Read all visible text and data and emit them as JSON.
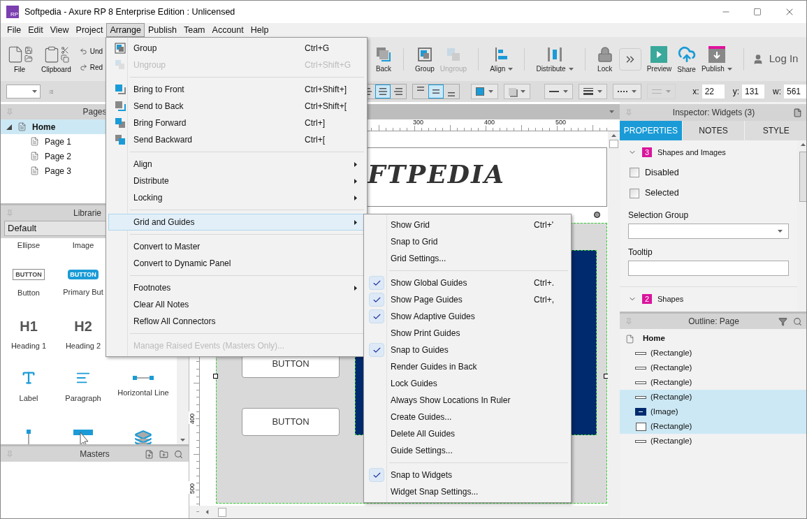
{
  "window": {
    "logo_text": "RP",
    "title": "Softpedia - Axure RP 8 Enterprise Edition : Unlicensed"
  },
  "menubar": [
    {
      "label": "File",
      "selected": false
    },
    {
      "label": "Edit",
      "selected": false
    },
    {
      "label": "View",
      "selected": false
    },
    {
      "label": "Project",
      "selected": false
    },
    {
      "label": "Arrange",
      "selected": true
    },
    {
      "label": "Publish",
      "selected": false
    },
    {
      "label": "Team",
      "selected": false
    },
    {
      "label": "Account",
      "selected": false
    },
    {
      "label": "Help",
      "selected": false
    }
  ],
  "toolbar_left": [
    {
      "label": "File"
    },
    {
      "label": "Clipboard"
    }
  ],
  "undo_redo": [
    "Und",
    "Red"
  ],
  "toolbar_right": [
    {
      "label": "Back",
      "disabled": false,
      "has_menu": false
    },
    {
      "label": "Group",
      "disabled": false,
      "has_menu": false
    },
    {
      "label": "Ungroup",
      "disabled": true,
      "has_menu": false
    },
    {
      "label": "Align",
      "disabled": false,
      "has_menu": true
    },
    {
      "label": "Distribute",
      "disabled": false,
      "has_menu": true
    },
    {
      "label": "Lock",
      "disabled": false,
      "has_menu": false
    },
    {
      "label": "Preview",
      "disabled": false,
      "has_menu": false
    },
    {
      "label": "Share",
      "disabled": false,
      "has_menu": false
    },
    {
      "label": "Publish",
      "disabled": false,
      "has_menu": true
    }
  ],
  "login": "Log In",
  "format_bar": {
    "h_align": [
      {
        "selected": false
      },
      {
        "selected": true
      },
      {
        "selected": false
      }
    ],
    "v_align": [
      {
        "selected": false
      },
      {
        "selected": true
      },
      {
        "selected": false
      }
    ],
    "fields": [
      {
        "label": "x:",
        "value": "22"
      },
      {
        "label": "y:",
        "value": "131"
      },
      {
        "label": "w:",
        "value": "561"
      }
    ]
  },
  "pages": {
    "title": "Pages",
    "tree": [
      {
        "label": "Home",
        "selected": true,
        "expanded": true,
        "children": [
          {
            "label": "Page 1",
            "selected": false
          },
          {
            "label": "Page 2",
            "selected": false
          },
          {
            "label": "Page 3",
            "selected": false
          }
        ]
      }
    ]
  },
  "libraries": {
    "title": "Librarie",
    "library": "Default",
    "rows": [
      [
        {
          "label": "Ellipse"
        },
        {
          "label": "Image"
        }
      ],
      [
        {
          "label": "Button",
          "icon_text": "BUTTON"
        },
        {
          "label": "Primary But",
          "icon_text": "BUTTON"
        }
      ],
      [
        {
          "label": "Heading 1",
          "icon_text": "H1"
        },
        {
          "label": "Heading 2",
          "icon_text": "H2"
        }
      ],
      [
        {
          "label": "Label"
        },
        {
          "label": "Paragraph"
        },
        {
          "label": "Horizontal Line"
        }
      ],
      [
        {},
        {},
        {}
      ]
    ]
  },
  "masters": {
    "title": "Masters"
  },
  "canvas": {
    "h_ruler": [
      "300",
      "400",
      "500"
    ],
    "v_ruler": [
      "400",
      "500"
    ],
    "logo": "FTPEDIA",
    "buttons": [
      "BUTTON",
      "BUTTON"
    ]
  },
  "arrange_menu": [
    {
      "kind": "item",
      "label": "Group",
      "shortcut": "Ctrl+G",
      "disabled": false,
      "submenu": false,
      "selected": false
    },
    {
      "kind": "item",
      "label": "Ungroup",
      "shortcut": "Ctrl+Shift+G",
      "disabled": true,
      "submenu": false,
      "selected": false
    },
    {
      "kind": "separator"
    },
    {
      "kind": "item",
      "label": "Bring to Front",
      "shortcut": "Ctrl+Shift+]",
      "disabled": false,
      "submenu": false,
      "selected": false
    },
    {
      "kind": "item",
      "label": "Send to Back",
      "shortcut": "Ctrl+Shift+[",
      "disabled": false,
      "submenu": false,
      "selected": false
    },
    {
      "kind": "item",
      "label": "Bring Forward",
      "shortcut": "Ctrl+]",
      "disabled": false,
      "submenu": false,
      "selected": false
    },
    {
      "kind": "item",
      "label": "Send Backward",
      "shortcut": "Ctrl+[",
      "disabled": false,
      "submenu": false,
      "selected": false
    },
    {
      "kind": "separator"
    },
    {
      "kind": "item",
      "label": "Align",
      "disabled": false,
      "submenu": true,
      "selected": false
    },
    {
      "kind": "item",
      "label": "Distribute",
      "disabled": false,
      "submenu": true,
      "selected": false
    },
    {
      "kind": "item",
      "label": "Locking",
      "disabled": false,
      "submenu": true,
      "selected": false
    },
    {
      "kind": "separator"
    },
    {
      "kind": "item",
      "label": "Grid and Guides",
      "disabled": false,
      "submenu": true,
      "selected": true
    },
    {
      "kind": "separator"
    },
    {
      "kind": "item",
      "label": "Convert to Master",
      "disabled": false,
      "submenu": false,
      "selected": false
    },
    {
      "kind": "item",
      "label": "Convert to Dynamic Panel",
      "disabled": false,
      "submenu": false,
      "selected": false
    },
    {
      "kind": "separator"
    },
    {
      "kind": "item",
      "label": "Footnotes",
      "disabled": false,
      "submenu": true,
      "selected": false
    },
    {
      "kind": "item",
      "label": "Clear All Notes",
      "disabled": false,
      "submenu": false,
      "selected": false
    },
    {
      "kind": "item",
      "label": "Reflow All Connectors",
      "disabled": false,
      "submenu": false,
      "selected": false
    },
    {
      "kind": "separator"
    },
    {
      "kind": "item",
      "label": "Manage Raised Events (Masters Only)...",
      "disabled": true,
      "submenu": false,
      "selected": false
    }
  ],
  "guides_menu": [
    {
      "kind": "item",
      "label": "Show Grid",
      "shortcut": "Ctrl+'",
      "checked": false
    },
    {
      "kind": "item",
      "label": "Snap to Grid",
      "checked": false
    },
    {
      "kind": "item",
      "label": "Grid Settings...",
      "checked": false
    },
    {
      "kind": "separator"
    },
    {
      "kind": "item",
      "label": "Show Global Guides",
      "shortcut": "Ctrl+.",
      "checked": true
    },
    {
      "kind": "item",
      "label": "Show Page Guides",
      "shortcut": "Ctrl+,",
      "checked": true
    },
    {
      "kind": "item",
      "label": "Show Adaptive Guides",
      "checked": true
    },
    {
      "kind": "item",
      "label": "Show Print Guides",
      "checked": false
    },
    {
      "kind": "item",
      "label": "Snap to Guides",
      "checked": true
    },
    {
      "kind": "item",
      "label": "Render Guides in Back",
      "checked": false
    },
    {
      "kind": "item",
      "label": "Lock Guides",
      "checked": false
    },
    {
      "kind": "item",
      "label": "Always Show Locations In Ruler",
      "checked": false
    },
    {
      "kind": "item",
      "label": "Create Guides...",
      "checked": false
    },
    {
      "kind": "item",
      "label": "Delete All Guides",
      "checked": false
    },
    {
      "kind": "item",
      "label": "Guide Settings...",
      "checked": false
    },
    {
      "kind": "separator"
    },
    {
      "kind": "item",
      "label": "Snap to Widgets",
      "checked": true
    },
    {
      "kind": "item",
      "label": "Widget Snap Settings...",
      "checked": false
    }
  ],
  "inspector": {
    "title": "Inspector: Widgets (3)",
    "tabs": [
      {
        "label": "PROPERTIES",
        "selected": true
      },
      {
        "label": "NOTES",
        "selected": false
      },
      {
        "label": "STYLE",
        "selected": false
      }
    ],
    "section": {
      "count": "3",
      "title": "Shapes and Images"
    },
    "checkboxes": [
      {
        "label": "Disabled",
        "checked": false
      },
      {
        "label": "Selected",
        "checked": false
      }
    ],
    "selection_group": {
      "label": "Selection Group"
    },
    "tooltip": {
      "label": "Tooltip"
    },
    "section2": {
      "count": "2",
      "title": "Shapes"
    }
  },
  "outline": {
    "title": "Outline: Page",
    "root": "Home",
    "items": [
      {
        "kind": "line",
        "label": "(Rectangle)",
        "selected": false
      },
      {
        "kind": "line",
        "label": "(Rectangle)",
        "selected": false
      },
      {
        "kind": "line",
        "label": "(Rectangle)",
        "selected": false
      },
      {
        "kind": "line",
        "label": "(Rectangle)",
        "selected": true
      },
      {
        "kind": "image",
        "label": "(Image)",
        "selected": true
      },
      {
        "kind": "box",
        "label": "(Rectangle)",
        "selected": true
      },
      {
        "kind": "line",
        "label": "(Rectangle)",
        "selected": false
      }
    ]
  }
}
